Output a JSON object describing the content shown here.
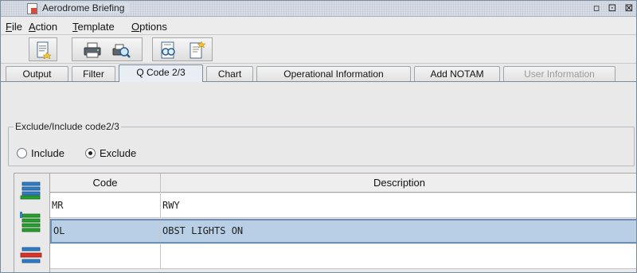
{
  "window": {
    "title": "Aerodrome Briefing",
    "restore_label": "▫",
    "maximize_label": "⊡",
    "close_label": "⊠"
  },
  "menu": {
    "items": [
      {
        "mnemonic": "F",
        "rest": "ile"
      },
      {
        "mnemonic": "A",
        "rest": "ction"
      },
      {
        "mnemonic": "T",
        "rest": "emplate"
      },
      {
        "mnemonic": "O",
        "rest": "ptions"
      }
    ]
  },
  "toolbar": {
    "buttons": [
      "new-document-icon",
      "print-icon",
      "print-preview-icon",
      "view-icon",
      "new-template-icon"
    ]
  },
  "tabs": [
    {
      "label": "Output"
    },
    {
      "label": "Filter"
    },
    {
      "label": "Q Code 2/3",
      "active": true
    },
    {
      "label": "Chart"
    },
    {
      "label": "Operational Information"
    },
    {
      "label": "Add NOTAM"
    },
    {
      "label": "User Information",
      "disabled": true
    }
  ],
  "exclude_group": {
    "legend": "Exclude/Include code2/3",
    "include_label": "Include",
    "exclude_label": "Exclude",
    "selected": "Exclude"
  },
  "side_buttons": [
    "add-row-icon",
    "insert-row-icon",
    "delete-row-icon"
  ],
  "table": {
    "columns": [
      "Code",
      "Description"
    ],
    "rows": [
      {
        "code": "MR",
        "description": "RWY"
      },
      {
        "code": "OL",
        "description": "OBST LIGHTS ON",
        "selected": true
      },
      {
        "code": "",
        "description": ""
      }
    ]
  },
  "colors": {
    "selection_bg": "#b8cfe5",
    "selection_border": "#6d8fb3",
    "tab_active_bg": "#e9eef5"
  }
}
